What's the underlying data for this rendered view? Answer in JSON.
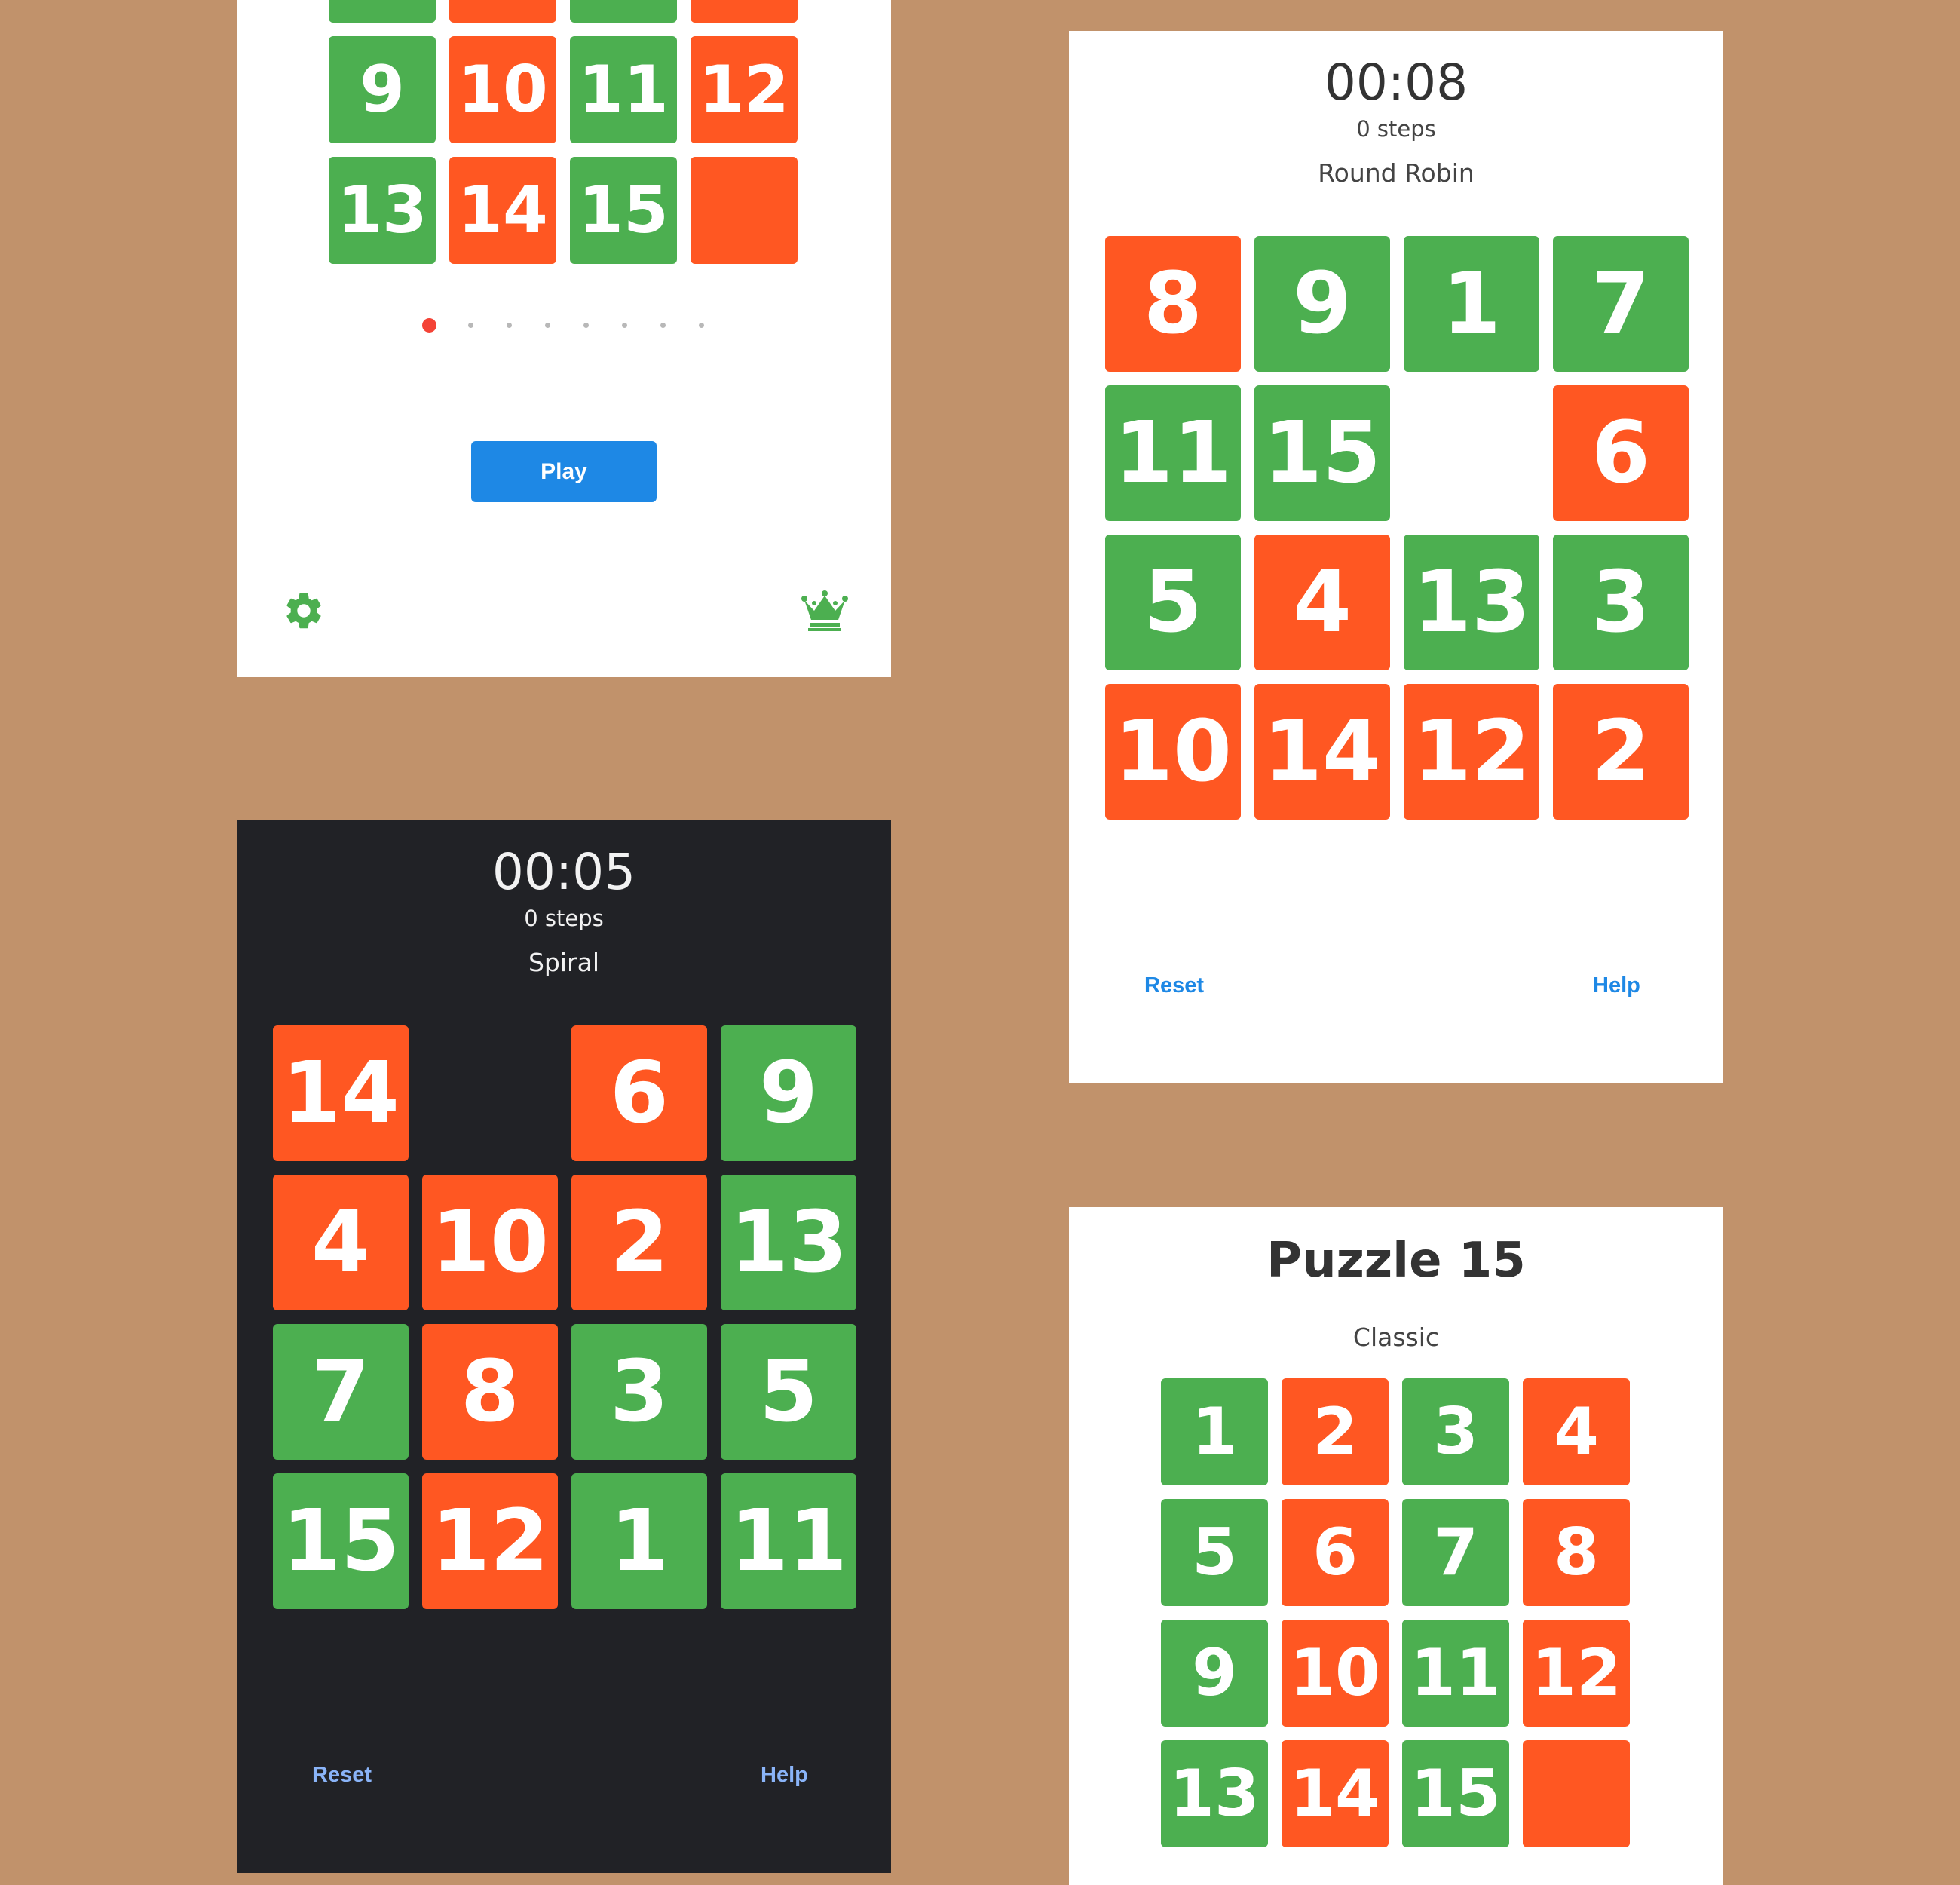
{
  "colors": {
    "background": "#C1926B",
    "green": "#4CAF50",
    "orange": "#FF5722",
    "primary": "#1E88E5",
    "dark_panel": "#212226"
  },
  "menu_panel": {
    "tiles": [
      {
        "label": "",
        "color": "green"
      },
      {
        "label": "",
        "color": "orange"
      },
      {
        "label": "",
        "color": "green"
      },
      {
        "label": "",
        "color": "orange"
      },
      {
        "label": "9",
        "color": "green"
      },
      {
        "label": "10",
        "color": "orange"
      },
      {
        "label": "11",
        "color": "green"
      },
      {
        "label": "12",
        "color": "orange"
      },
      {
        "label": "13",
        "color": "green"
      },
      {
        "label": "14",
        "color": "orange"
      },
      {
        "label": "15",
        "color": "green"
      },
      {
        "label": "",
        "color": "orange"
      }
    ],
    "pager": {
      "count": 8,
      "active_index": 0
    },
    "play_label": "Play",
    "settings_icon": "gear-icon",
    "leaderboard_icon": "crown-icon"
  },
  "round_robin_panel": {
    "timer": "00:08",
    "steps": "0 steps",
    "mode": "Round Robin",
    "tiles": [
      {
        "label": "8",
        "color": "orange"
      },
      {
        "label": "9",
        "color": "green"
      },
      {
        "label": "1",
        "color": "green"
      },
      {
        "label": "7",
        "color": "green"
      },
      {
        "label": "11",
        "color": "green"
      },
      {
        "label": "15",
        "color": "green"
      },
      {
        "label": "",
        "color": "blank"
      },
      {
        "label": "6",
        "color": "orange"
      },
      {
        "label": "5",
        "color": "green"
      },
      {
        "label": "4",
        "color": "orange"
      },
      {
        "label": "13",
        "color": "green"
      },
      {
        "label": "3",
        "color": "green"
      },
      {
        "label": "10",
        "color": "orange"
      },
      {
        "label": "14",
        "color": "orange"
      },
      {
        "label": "12",
        "color": "orange"
      },
      {
        "label": "2",
        "color": "orange"
      }
    ],
    "reset_label": "Reset",
    "help_label": "Help"
  },
  "spiral_panel": {
    "timer": "00:05",
    "steps": "0 steps",
    "mode": "Spiral",
    "tiles": [
      {
        "label": "14",
        "color": "orange"
      },
      {
        "label": "",
        "color": "blank"
      },
      {
        "label": "6",
        "color": "orange"
      },
      {
        "label": "9",
        "color": "green"
      },
      {
        "label": "4",
        "color": "orange"
      },
      {
        "label": "10",
        "color": "orange"
      },
      {
        "label": "2",
        "color": "orange"
      },
      {
        "label": "13",
        "color": "green"
      },
      {
        "label": "7",
        "color": "green"
      },
      {
        "label": "8",
        "color": "orange"
      },
      {
        "label": "3",
        "color": "green"
      },
      {
        "label": "5",
        "color": "green"
      },
      {
        "label": "15",
        "color": "green"
      },
      {
        "label": "12",
        "color": "orange"
      },
      {
        "label": "1",
        "color": "green"
      },
      {
        "label": "11",
        "color": "green"
      }
    ],
    "reset_label": "Reset",
    "help_label": "Help"
  },
  "classic_panel": {
    "title": "Puzzle 15",
    "mode": "Classic",
    "tiles": [
      {
        "label": "1",
        "color": "green"
      },
      {
        "label": "2",
        "color": "orange"
      },
      {
        "label": "3",
        "color": "green"
      },
      {
        "label": "4",
        "color": "orange"
      },
      {
        "label": "5",
        "color": "green"
      },
      {
        "label": "6",
        "color": "orange"
      },
      {
        "label": "7",
        "color": "green"
      },
      {
        "label": "8",
        "color": "orange"
      },
      {
        "label": "9",
        "color": "green"
      },
      {
        "label": "10",
        "color": "orange"
      },
      {
        "label": "11",
        "color": "green"
      },
      {
        "label": "12",
        "color": "orange"
      },
      {
        "label": "13",
        "color": "green"
      },
      {
        "label": "14",
        "color": "orange"
      },
      {
        "label": "15",
        "color": "green"
      },
      {
        "label": "",
        "color": "orange"
      }
    ]
  }
}
